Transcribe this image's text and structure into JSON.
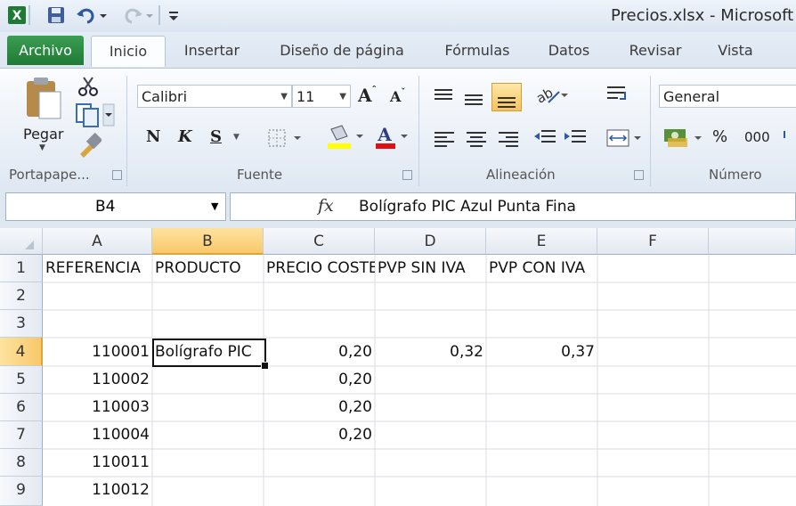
{
  "window": {
    "title": "Precios.xlsx - Microsoft E"
  },
  "tabs": {
    "file": "Archivo",
    "items": [
      "Inicio",
      "Insertar",
      "Diseño de página",
      "Fórmulas",
      "Datos",
      "Revisar",
      "Vista"
    ]
  },
  "ribbon": {
    "clipboard": {
      "paste_label": "Pegar",
      "group_label": "Portapape..."
    },
    "font": {
      "family": "Calibri",
      "size": "11",
      "bold": "N",
      "italic": "K",
      "underline": "S",
      "group_label": "Fuente"
    },
    "alignment": {
      "group_label": "Alineación"
    },
    "number": {
      "format": "General",
      "percent": "%",
      "thousands": "000",
      "group_label": "Número"
    }
  },
  "formula_bar": {
    "name_box": "B4",
    "fx_label": "fx",
    "content": "Bolígrafo PIC Azul Punta Fina"
  },
  "sheet": {
    "columns": [
      "A",
      "B",
      "C",
      "D",
      "E",
      "F"
    ],
    "rows": [
      "1",
      "2",
      "3",
      "4",
      "5",
      "6",
      "7",
      "8",
      "9"
    ],
    "selected_cell": "B4",
    "headers": {
      "a": "REFERENCIA",
      "b": "PRODUCTO",
      "c": "PRECIO COSTE",
      "d": "PVP SIN IVA",
      "e": "PVP CON IVA"
    },
    "data": {
      "a4": "110001",
      "b4": "Bolígrafo PIC",
      "c4": "0,20",
      "d4": "0,32",
      "e4": "0,37",
      "a5": "110002",
      "c5": "0,20",
      "a6": "110003",
      "c6": "0,20",
      "a7": "110004",
      "c7": "0,20",
      "a8": "110011",
      "a9": "110012"
    }
  },
  "colors": {
    "excel_green": "#1f7a35",
    "selection_orange": "#f8c86a",
    "ribbon_blue": "#dfe8f3"
  }
}
